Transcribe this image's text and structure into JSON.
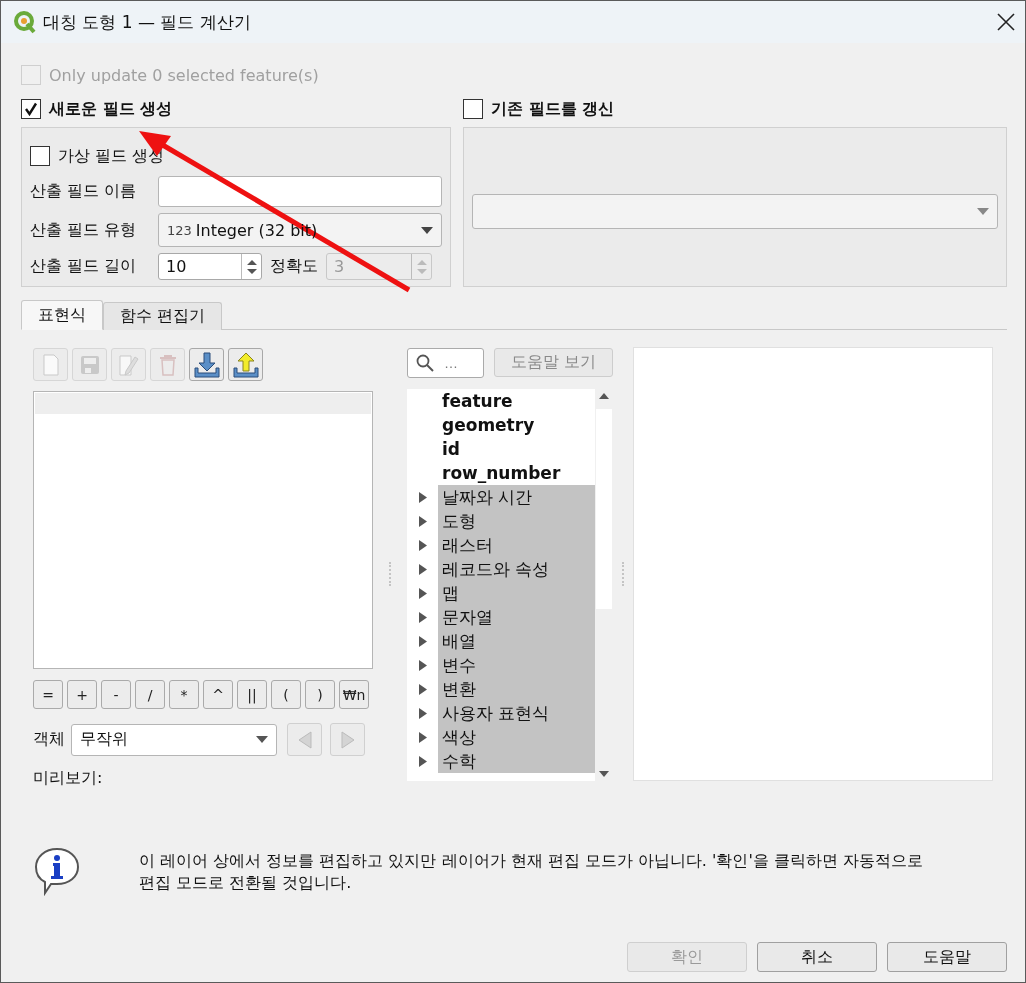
{
  "window": {
    "title": "대칭 도형 1 — 필드 계산기"
  },
  "only_selected": {
    "label": "Only update 0 selected feature(s)",
    "checked": false,
    "disabled": true
  },
  "new_field": {
    "label": "새로운 필드 생성",
    "checked": true,
    "virtual": {
      "label": "가상 필드 생성",
      "checked": false
    },
    "name_label": "산출 필드 이름",
    "type_label": "산출 필드 유형",
    "type_prefix": "123",
    "type_value": "Integer (32 bit)",
    "length_label": "산출 필드 길이",
    "length_value": "10",
    "precision_label": "정확도",
    "precision_value": "3",
    "precision_disabled": true
  },
  "update_field": {
    "label": "기존 필드를 갱신",
    "checked": false
  },
  "tabs": [
    {
      "label": "표현식",
      "selected": true
    },
    {
      "label": "함수 편집기",
      "selected": false
    }
  ],
  "toolbar": [
    {
      "kind": "new",
      "disabled": true
    },
    {
      "kind": "save",
      "disabled": true
    },
    {
      "kind": "edit",
      "disabled": true
    },
    {
      "kind": "delete",
      "disabled": true
    },
    {
      "kind": "import",
      "disabled": false
    },
    {
      "kind": "export",
      "disabled": false
    }
  ],
  "operators": [
    "=",
    "+",
    "-",
    "/",
    "*",
    "^",
    "||",
    "(",
    ")",
    "₩n"
  ],
  "feature": {
    "label": "객체",
    "value": "무작위"
  },
  "preview_label": "미리보기:",
  "search": {
    "placeholder": "…"
  },
  "help_button": {
    "label": "도움말 보기",
    "disabled": true
  },
  "tree": [
    {
      "kind": "field",
      "label": "feature"
    },
    {
      "kind": "field",
      "label": "geometry"
    },
    {
      "kind": "field",
      "label": "id"
    },
    {
      "kind": "field",
      "label": "row_number"
    },
    {
      "kind": "group",
      "label": "날짜와 시간",
      "expanded": false
    },
    {
      "kind": "group",
      "label": "도형",
      "expanded": false
    },
    {
      "kind": "group",
      "label": "래스터",
      "expanded": false
    },
    {
      "kind": "group",
      "label": "레코드와 속성",
      "expanded": false
    },
    {
      "kind": "group",
      "label": "맵",
      "expanded": false
    },
    {
      "kind": "group",
      "label": "문자열",
      "expanded": false
    },
    {
      "kind": "group",
      "label": "배열",
      "expanded": false
    },
    {
      "kind": "group",
      "label": "변수",
      "expanded": false
    },
    {
      "kind": "group",
      "label": "변환",
      "expanded": false
    },
    {
      "kind": "group",
      "label": "사용자 표현식",
      "expanded": false
    },
    {
      "kind": "group",
      "label": "색상",
      "expanded": false
    },
    {
      "kind": "group",
      "label": "수학",
      "expanded": false
    }
  ],
  "message": "이 레이어 상에서 정보를 편집하고 있지만 레이어가 현재 편집 모드가 아닙니다. '확인'을 클릭하면 자동적으로 편집 모드로 전환될 것입니다.",
  "buttons": [
    {
      "label": "확인",
      "disabled": true
    },
    {
      "label": "취소",
      "disabled": false
    },
    {
      "label": "도움말",
      "disabled": false
    }
  ]
}
